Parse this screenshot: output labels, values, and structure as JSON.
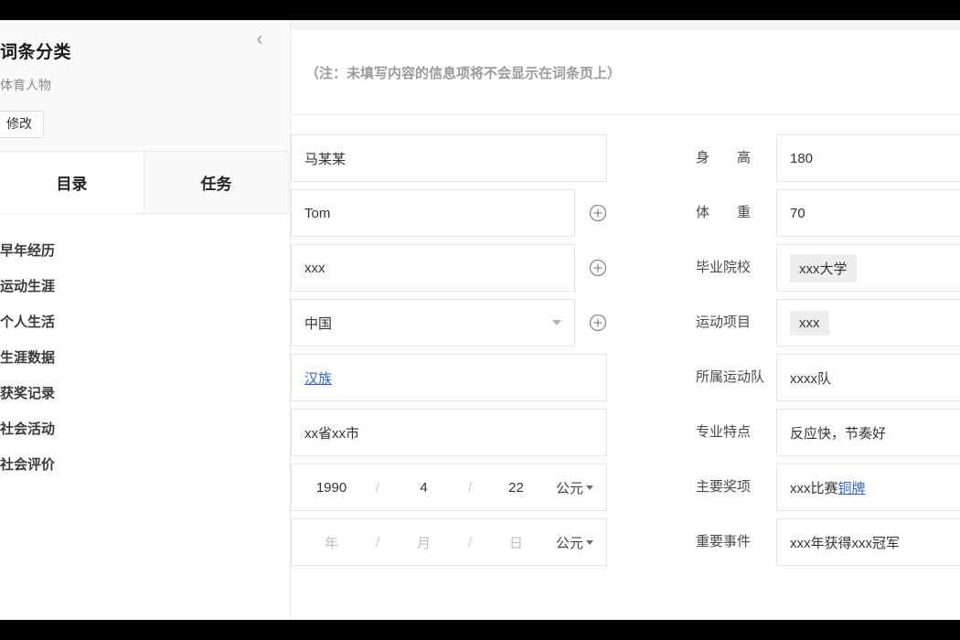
{
  "sidebar": {
    "collapse_icon": "chevron-left-icon",
    "title": "词条分类",
    "category": "体育人物",
    "modify_label": "修改",
    "tabs": [
      {
        "label": "目录",
        "active": true
      },
      {
        "label": "任务",
        "active": false
      }
    ],
    "toc": [
      {
        "label": "早年经历"
      },
      {
        "label": "运动生涯"
      },
      {
        "label": "个人生活"
      },
      {
        "label": "生涯数据"
      },
      {
        "label": "获奖记录"
      },
      {
        "label": "社会活动"
      },
      {
        "label": "社会评价"
      }
    ]
  },
  "main": {
    "notice": "（注：未填写内容的信息项将不会显示在词条页上）",
    "left_fields": [
      {
        "value": "马某某",
        "has_plus": false,
        "type": "text"
      },
      {
        "value": "Tom",
        "has_plus": true,
        "type": "text"
      },
      {
        "value": "xxx",
        "has_plus": true,
        "type": "text"
      },
      {
        "value": "中国",
        "has_plus": true,
        "type": "select"
      },
      {
        "value": "汉族",
        "has_plus": false,
        "type": "link"
      },
      {
        "value": "xx省xx市",
        "has_plus": false,
        "type": "text"
      }
    ],
    "date_rows": [
      {
        "year": "1990",
        "month": "4",
        "day": "22",
        "sep": "/",
        "era": "公元",
        "placeholder": false
      },
      {
        "year": "年",
        "month": "月",
        "day": "日",
        "sep": "/",
        "era": "公元",
        "placeholder": true
      }
    ],
    "right_fields": [
      {
        "label": "身　　高",
        "value": "180",
        "style": "plain"
      },
      {
        "label": "体　　重",
        "value": "70",
        "style": "plain"
      },
      {
        "label": "毕业院校",
        "value": "xxx大学",
        "style": "tag"
      },
      {
        "label": "运动项目",
        "value": "xxx",
        "style": "tag"
      },
      {
        "label": "所属运动队",
        "value": "xxxx队",
        "style": "plain"
      },
      {
        "label": "专业特点",
        "value": "反应快，节奏好",
        "style": "plain"
      },
      {
        "label": "主要奖项",
        "value": "xxx比赛",
        "link_value": "铜牌",
        "style": "link"
      },
      {
        "label": "重要事件",
        "value": "xxx年获得xxx冠军",
        "style": "plain"
      }
    ]
  },
  "colors": {
    "link": "#3366cc",
    "border": "#e4e4e4",
    "notice_text": "#9b9b9b",
    "panel_bg": "#fafafa",
    "chrome": "#000000"
  }
}
